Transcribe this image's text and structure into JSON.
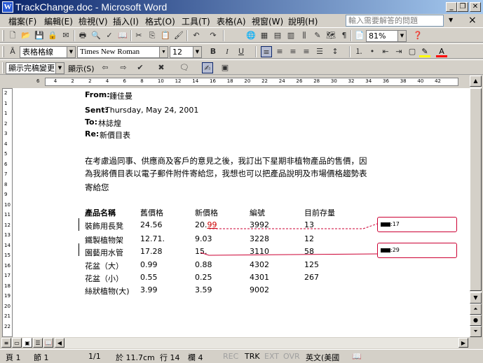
{
  "window": {
    "title": "TrackChange.doc - Microsoft Word",
    "app_icon": "W",
    "minimize": "_",
    "restore": "❐",
    "close": "✕"
  },
  "menu": {
    "items": [
      "檔案(F)",
      "編輯(E)",
      "檢視(V)",
      "插入(I)",
      "格式(O)",
      "工具(T)",
      "表格(A)",
      "視窗(W)",
      "說明(H)"
    ],
    "help_placeholder": "輸入需要解答的問題",
    "doc_close": "×"
  },
  "toolbar_standard": {
    "zoom": "81%"
  },
  "toolbar_format": {
    "style": "表格格線",
    "font": "Times New Roman",
    "size": "12"
  },
  "toolbar_review": {
    "display": "顯示完稿變更",
    "show": "顯示(S)"
  },
  "ruler": {
    "h_ticks": [
      "6",
      "4",
      "2",
      "2",
      "4",
      "6",
      "8",
      "10",
      "12",
      "14",
      "16",
      "18",
      "20",
      "22",
      "24",
      "26",
      "28",
      "30",
      "32",
      "34",
      "36",
      "38",
      "40",
      "42"
    ],
    "v_ticks": [
      "2",
      "1",
      "1",
      "2",
      "3",
      "4",
      "5",
      "6",
      "7",
      "8",
      "9",
      "10",
      "11",
      "12",
      "13",
      "14",
      "15",
      "16",
      "17",
      "18",
      "19",
      "20",
      "21",
      "22"
    ]
  },
  "doc": {
    "from_label": "From:",
    "from_value": "鍾佳曼",
    "sent_label": "Sent:",
    "sent_value": "Thursday, May 24, 2001",
    "to_label": "To:",
    "to_value": "林誌煌",
    "re_label": "Re:",
    "re_value": "新價目表",
    "body_lines": [
      "在考慮過同事、供應商及客戶的意見之後，我訂出下星期非植物產品的售價，因",
      "為我將價目表以電子郵件附件寄給您，我想也可以把產品說明及市場價格趨勢表",
      "寄給您"
    ],
    "table": {
      "headers": [
        "產品名稱",
        "舊價格",
        "新價格",
        "編號",
        "目前存量"
      ],
      "rows": [
        [
          "裝飾用長凳",
          "24.56",
          "20.",
          "3992",
          "13"
        ],
        [
          "鐵製植物架",
          "12.71.",
          "9.03",
          "3228",
          "12"
        ],
        [
          "園藝用水管",
          "17.28",
          "15.",
          "3110",
          "58"
        ],
        [
          "花盆（大）",
          "0.99",
          "0.88",
          "4302",
          "125"
        ],
        [
          "花盆（小）",
          "0.55",
          "0.25",
          "4301",
          "267"
        ],
        [
          "絲狀植物(大)",
          "3.99",
          "3.59",
          "9002",
          ""
        ]
      ],
      "inserted_text": "99"
    },
    "balloons": [
      ":17",
      ":29"
    ]
  },
  "statusbar": {
    "page": "頁 1",
    "section": "節 1",
    "pages": "1/1",
    "at": "於 11.7cm",
    "line": "行 14",
    "col": "欄 4",
    "rec": "REC",
    "trk": "TRK",
    "ext": "EXT",
    "ovr": "OVR",
    "lang": "英文(美國"
  },
  "colors": {
    "title_start": "#0a246a",
    "title_end": "#a6caf0",
    "revision": "#cc0033"
  }
}
